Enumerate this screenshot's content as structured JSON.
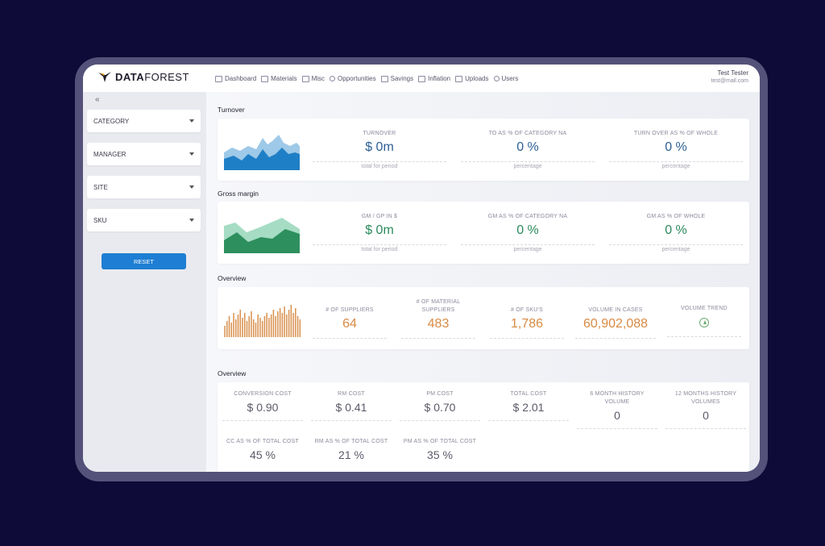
{
  "brand": {
    "bold": "DATA",
    "light": "FOREST"
  },
  "nav": [
    {
      "label": "Dashboard",
      "icon": "dashboard-icon"
    },
    {
      "label": "Materials",
      "icon": "materials-icon"
    },
    {
      "label": "Misc",
      "icon": "misc-icon"
    },
    {
      "label": "Opportunities",
      "icon": "user-icon"
    },
    {
      "label": "Savings",
      "icon": "savings-icon"
    },
    {
      "label": "Inflation",
      "icon": "inflation-icon"
    },
    {
      "label": "Uploads",
      "icon": "uploads-icon"
    },
    {
      "label": "Users",
      "icon": "user-icon"
    }
  ],
  "user": {
    "name": "Test Tester",
    "email": "test@mail.com"
  },
  "sidebar": {
    "collapse": "«",
    "filters": [
      "CATEGORY",
      "MANAGER",
      "SITE",
      "SKU"
    ],
    "reset_label": "RESET"
  },
  "turnover": {
    "title": "Turnover",
    "kpis": [
      {
        "label": "TURNOVER",
        "value": "$ 0m",
        "sub": "total for period"
      },
      {
        "label": "TO AS % OF CATEGORY NA",
        "value": "0 %",
        "sub": "percentage"
      },
      {
        "label": "TURN OVER AS % OF WHOLE",
        "value": "0 %",
        "sub": "percentage"
      }
    ]
  },
  "gross_margin": {
    "title": "Gross margin",
    "kpis": [
      {
        "label": "GM / GP IN $",
        "value": "$ 0m",
        "sub": "total for period"
      },
      {
        "label": "GM AS % OF CATEGORY NA",
        "value": "0 %",
        "sub": "percentage"
      },
      {
        "label": "GM AS % OF WHOLE",
        "value": "0 %",
        "sub": "percentage"
      }
    ]
  },
  "overview1": {
    "title": "Overview",
    "kpis": [
      {
        "label": "# OF SUPPLIERS",
        "value": "64"
      },
      {
        "label": "# OF MATERIAL SUPPLIERS",
        "value": "483"
      },
      {
        "label": "# OF SKU'S",
        "value": "1,786"
      },
      {
        "label": "VOLUME IN CASES",
        "value": "60,902,088"
      },
      {
        "label": "VOLUME TREND",
        "value": ""
      }
    ]
  },
  "overview2": {
    "title": "Overview",
    "row1": [
      {
        "label": "CONVERSION COST",
        "value": "$ 0.90"
      },
      {
        "label": "RM COST",
        "value": "$ 0.41"
      },
      {
        "label": "PM COST",
        "value": "$ 0.70"
      },
      {
        "label": "TOTAL COST",
        "value": "$ 2.01"
      },
      {
        "label": "6 MONTH HISTORY VOLUME",
        "value": "0"
      },
      {
        "label": "12 MONTHS HISTORY VOLUMES",
        "value": "0"
      }
    ],
    "row2": [
      {
        "label": "CC AS % OF TOTAL COST",
        "value": "45 %"
      },
      {
        "label": "RM AS % OF TOTAL COST",
        "value": "21 %"
      },
      {
        "label": "PM AS % OF TOTAL COST",
        "value": "35 %"
      }
    ]
  },
  "colors": {
    "accent": "#1d7ed3",
    "turnover_light": "#9ec9e8",
    "turnover_dark": "#1f7fc6",
    "gm_light": "#a6dcc4",
    "gm_dark": "#2e8f5e",
    "bars": "#d9914e"
  }
}
